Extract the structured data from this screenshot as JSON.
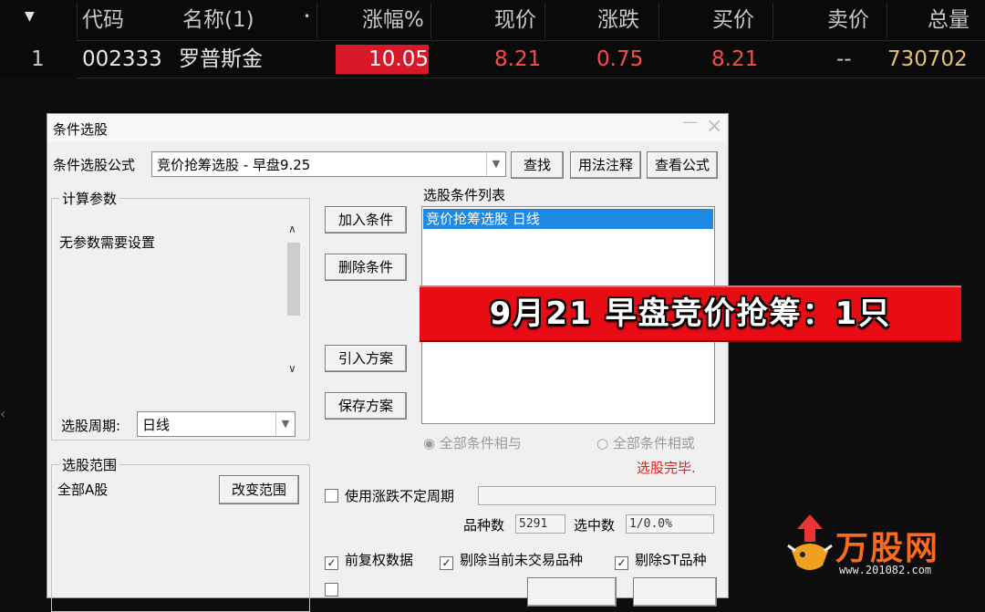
{
  "quote_table": {
    "headers": [
      "代码",
      "名称(1)",
      "涨幅%",
      "现价",
      "涨跌",
      "买价",
      "卖价",
      "总量"
    ],
    "sort_dot": "•",
    "row": {
      "index": "1",
      "code": "002333",
      "name": "罗普斯金",
      "change_pct": "10.05",
      "price": "8.21",
      "change": "0.75",
      "bid": "8.21",
      "ask": "--",
      "volume": "730702"
    },
    "colors": {
      "up": "#ff4a4a",
      "highlight_bg": "#d8192a",
      "volume": "#e8c070",
      "header": "#c8c8c8"
    }
  },
  "dialog": {
    "title": "条件选股",
    "close_icon": "×",
    "formula_label": "条件选股公式",
    "formula_value": "竞价抢筹选股 - 早盘9.25",
    "buttons": {
      "find": "查找",
      "usage_notes": "用法注释",
      "view_formula": "查看公式",
      "add_condition": "加入条件",
      "delete_condition": "删除条件",
      "import_plan": "引入方案",
      "save_plan": "保存方案",
      "change_range": "改变范围"
    },
    "params_group_title": "计算参数",
    "params_text": "无参数需要设置",
    "period_label": "选股周期:",
    "period_value": "日线",
    "condition_list_title": "选股条件列表",
    "condition_items": [
      "竞价抢筹选股  日线"
    ],
    "radio_and": "全部条件相与",
    "radio_or": "全部条件相或",
    "status": "选股完毕.",
    "range_group_title": "选股范围",
    "range_text": "全部A股",
    "use_period_label": "使用涨跌不定周期",
    "count_label": "品种数",
    "count_value": "5291",
    "selected_label": "选中数",
    "selected_value": "1/0.0%",
    "options": [
      "前复权数据",
      "剔除当前未交易品种",
      "剔除ST品种"
    ]
  },
  "banner": {
    "text": "9月21 早盘竞价抢筹：1只"
  },
  "watermark": {
    "brand": "万股网",
    "url": "www.201082.com"
  }
}
